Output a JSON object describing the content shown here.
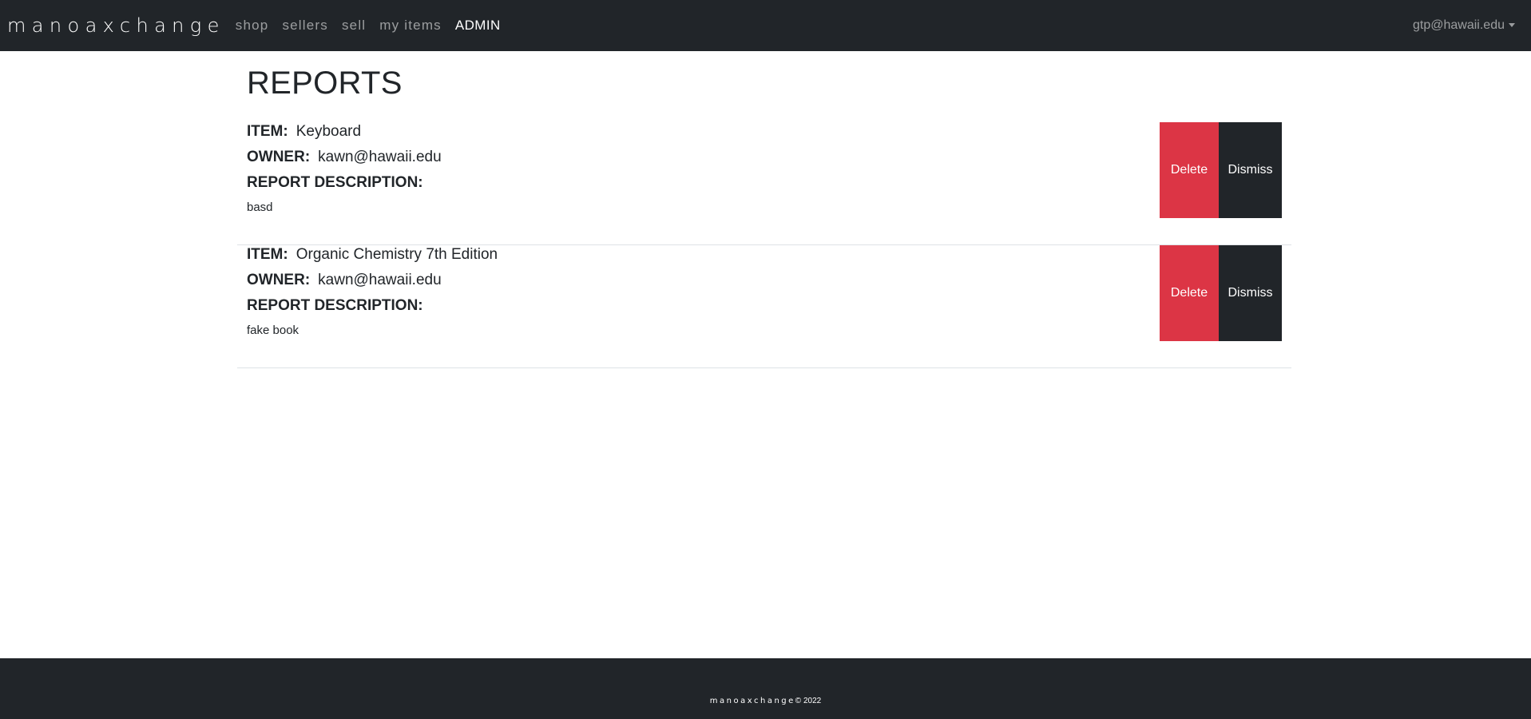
{
  "navbar": {
    "brand": "manoaxchange",
    "links": [
      {
        "label": "shop"
      },
      {
        "label": "sellers"
      },
      {
        "label": "sell"
      },
      {
        "label": "my items"
      },
      {
        "label": "ADMIN"
      }
    ],
    "user": "gtp@hawaii.edu"
  },
  "page": {
    "title": "REPORTS"
  },
  "labels": {
    "item": "ITEM:",
    "owner": "OWNER:",
    "description": "REPORT DESCRIPTION:"
  },
  "reports": [
    {
      "item": "Keyboard",
      "owner": "kawn@hawaii.edu",
      "description": "basd",
      "delete_label": "Delete",
      "dismiss_label": "Dismiss"
    },
    {
      "item": "Organic Chemistry 7th Edition",
      "owner": "kawn@hawaii.edu",
      "description": "fake book",
      "delete_label": "Delete",
      "dismiss_label": "Dismiss"
    }
  ],
  "footer": {
    "brand": "manoaxchange",
    "copyright": "© 2022"
  },
  "colors": {
    "navbar_bg": "#212529",
    "delete_bg": "#dc3545",
    "dismiss_bg": "#212529",
    "divider": "#dee2e6"
  }
}
